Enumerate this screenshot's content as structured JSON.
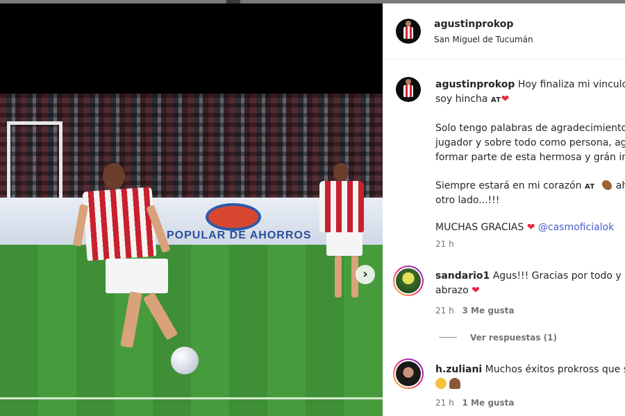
{
  "media": {
    "ad_text": "POPULAR DE AHORROS",
    "next_icon": "chevron-right-icon"
  },
  "post": {
    "username": "agustinprokop",
    "location": "San Miguel de Tucumán",
    "caption": {
      "line1": "Hoy finaliza mi vinculo c",
      "line2": "soy hincha",
      "tag_at": "AT",
      "para2_line1": "Solo tengo palabras de agradecimiento",
      "para2_line2": "jugador y sobre todo como persona, ag",
      "para2_line3": "formar parte de esta hermosa y grán in",
      "para3_line1": "Siempre estará en mi corazón",
      "para3_tail": "ah",
      "para3_line2": "otro lado...!!!",
      "para4": "MUCHAS GRACIAS",
      "mention": "@casmoficialok",
      "time": "21 h"
    }
  },
  "comments": [
    {
      "username": "sandario1",
      "line1": "Agus!!! Gracias por todo y mu",
      "line2": "abrazo",
      "time": "21 h",
      "likes": "3 Me gusta",
      "view_replies": "Ver respuestas (1)"
    },
    {
      "username": "h.zuliani",
      "line1": "Muchos éxitos prokross que se",
      "time": "21 h",
      "likes": "1 Me gusta"
    }
  ],
  "colors": {
    "heart": "#e8293f",
    "mention": "#4a5dc9",
    "meta": "#737373"
  }
}
